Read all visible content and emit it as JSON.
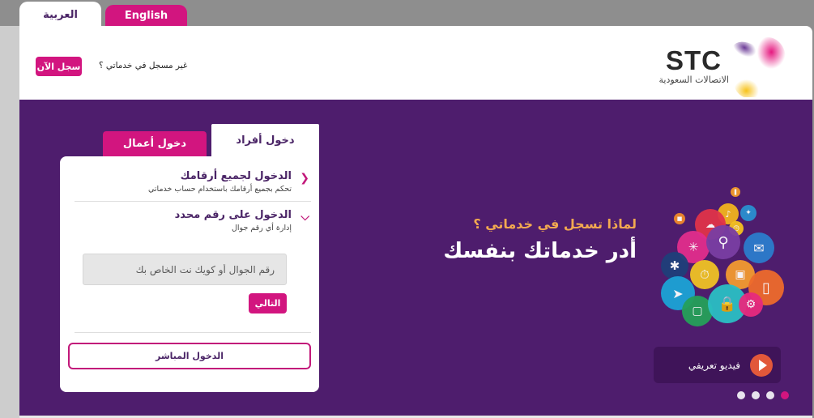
{
  "language_tabs": [
    {
      "label": "العربية",
      "active": true
    },
    {
      "label": "English",
      "active": false
    }
  ],
  "header": {
    "register_prompt": "غير مسجل في خدماتي ؟",
    "register_button": "سجل الآن",
    "logo": {
      "brand": "STC",
      "subtitle": "الاتصالات السعودية"
    }
  },
  "login": {
    "tabs": [
      {
        "label": "دخول أفراد",
        "active": true
      },
      {
        "label": "دخول أعمال",
        "active": false
      }
    ],
    "options": [
      {
        "title": "الدخول لجميع أرقامك",
        "subtitle": "تحكم بجميع أرقامك باستخدام حساب خدماتي",
        "icon": "chevron-left-icon",
        "expanded": false
      },
      {
        "title": "الدخول على رقم محدد",
        "subtitle": "إدارة أي رقم جوال",
        "icon": "chevron-down-icon",
        "expanded": true
      }
    ],
    "phone_input": {
      "value": "",
      "placeholder": "رقم الجوال أو كويك نت الخاص بك"
    },
    "next_button": "التالي",
    "direct_login_button": "الدخول المباشر"
  },
  "promo": {
    "question": "لماذا تسجل في خدماتي ؟",
    "headline": "أدر خدماتك بنفسك",
    "video_button": "فيديو تعريفي",
    "slides_total": 4,
    "active_slide": 1
  },
  "colors": {
    "brand_purple": "#4e1d6d",
    "brand_magenta": "#d2157f",
    "accent_orange": "#f2a950"
  }
}
